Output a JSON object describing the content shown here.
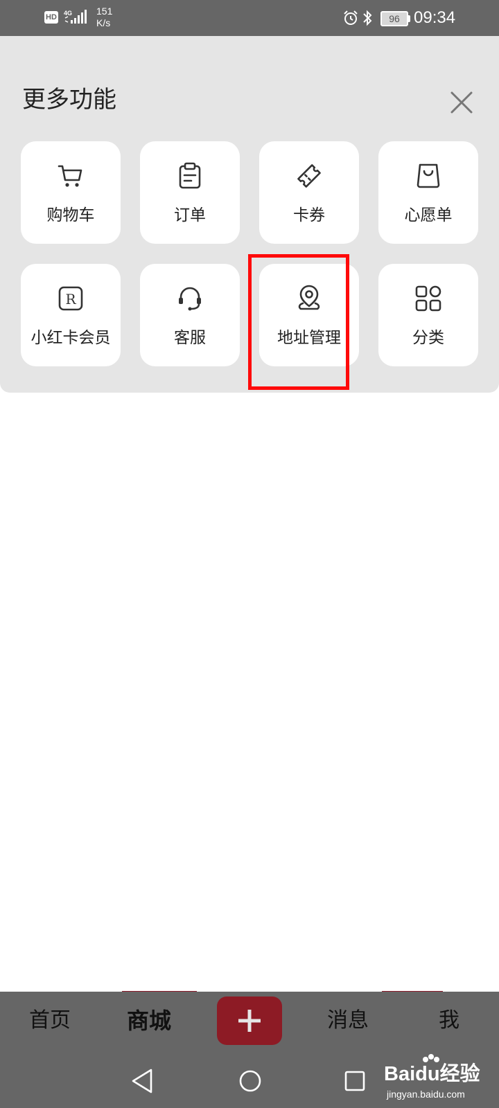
{
  "status_bar": {
    "hd_badge": "HD",
    "network": "4G",
    "speed_value": "151",
    "speed_unit": "K/s",
    "battery": "96",
    "time": "09:34"
  },
  "sheet": {
    "title": "更多功能",
    "items": [
      {
        "label": "购物车",
        "icon": "cart-icon"
      },
      {
        "label": "订单",
        "icon": "clipboard-icon"
      },
      {
        "label": "卡券",
        "icon": "coupon-ticket-icon"
      },
      {
        "label": "心愿单",
        "icon": "wishlist-bag-icon"
      },
      {
        "label": "小红卡会员",
        "icon": "r-badge-icon"
      },
      {
        "label": "客服",
        "icon": "headset-icon"
      },
      {
        "label": "地址管理",
        "icon": "location-pin-icon"
      },
      {
        "label": "分类",
        "icon": "category-grid-icon"
      }
    ],
    "highlighted_item": "地址管理"
  },
  "tabbar": {
    "tabs": [
      {
        "label": "首页",
        "active": false
      },
      {
        "label": "商城",
        "active": true
      },
      {
        "label": "消息",
        "active": false
      },
      {
        "label": "我",
        "active": false
      }
    ],
    "publish_button_icon": "plus-icon"
  },
  "watermark": {
    "brand": "Baidu",
    "brand_suffix": "经验",
    "url": "jingyan.baidu.com"
  },
  "colors": {
    "status_bar": "#666666",
    "sheet_bg": "#e5e5e5",
    "tile_bg": "#ffffff",
    "highlight_box": "#ff0a0a",
    "publish_button": "#8d1b25"
  }
}
